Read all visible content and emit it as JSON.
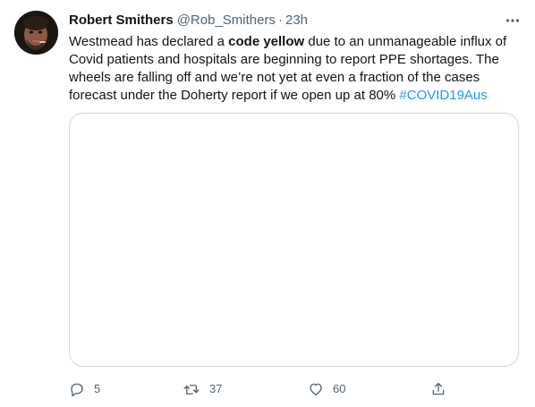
{
  "tweet": {
    "author": {
      "display_name": "Robert Smithers",
      "handle": "@Rob_Smithers",
      "separator": "·",
      "time": "23h"
    },
    "text": {
      "part1": "Westmead has declared a ",
      "bold": "code yellow",
      "part2": " due to an unmanageable influx of Covid patients and hospitals are beginning to report PPE shortages. The wheels are falling off and we’re not yet at even a fraction of the cases forecast under the Doherty report if we open up at 80% ",
      "hashtag": "#COVID19Aus"
    },
    "actions": {
      "reply": {
        "icon": "reply-icon",
        "count": "5"
      },
      "retweet": {
        "icon": "retweet-icon",
        "count": "37"
      },
      "like": {
        "icon": "heart-icon",
        "count": "60"
      },
      "share": {
        "icon": "share-icon"
      }
    },
    "more_icon": "more-icon"
  },
  "colors": {
    "text": "#0f1419",
    "secondary": "#536471",
    "link": "#1d9bf0",
    "border": "#cfd9de"
  }
}
